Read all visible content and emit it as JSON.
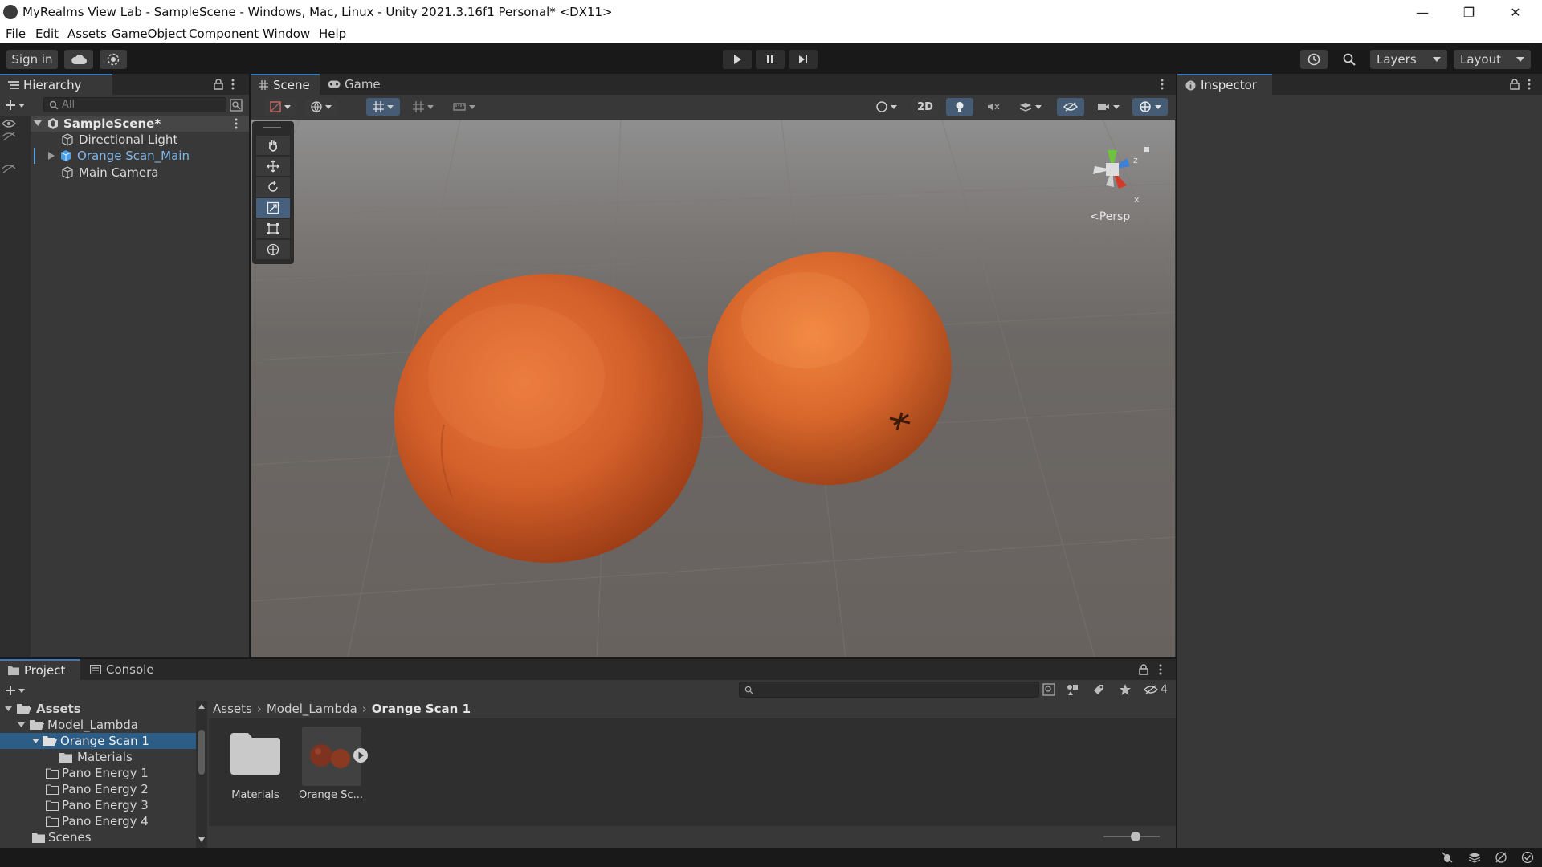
{
  "window": {
    "title": "MyRealms View Lab - SampleScene - Windows, Mac, Linux - Unity 2021.3.16f1 Personal* <DX11>",
    "controls": {
      "minimize": "—",
      "restore": "❐",
      "close": "✕"
    }
  },
  "menu": [
    "File",
    "Edit",
    "Assets",
    "GameObject",
    "Component",
    "Window",
    "Help"
  ],
  "toolbar": {
    "sign_in": "Sign in",
    "layers": "Layers",
    "layout": "Layout"
  },
  "hierarchy": {
    "tab": "Hierarchy",
    "search_placeholder": "All",
    "scene": "SampleScene*",
    "items": [
      {
        "label": "Directional Light",
        "selected": false
      },
      {
        "label": "Orange Scan_Main",
        "selected": true
      },
      {
        "label": "Main Camera",
        "selected": false
      }
    ]
  },
  "scene": {
    "tabs": [
      "Scene",
      "Game"
    ],
    "mode_2d": "2D",
    "projection": "Persp",
    "axes": {
      "x": "x",
      "y": "y",
      "z": "z"
    },
    "tools": [
      "hand",
      "move",
      "rotate",
      "scale",
      "rect",
      "transform"
    ]
  },
  "inspector": {
    "tab": "Inspector"
  },
  "project": {
    "tabs": [
      "Project",
      "Console"
    ],
    "hidden_count": "4",
    "breadcrumb": [
      "Assets",
      "Model_Lambda",
      "Orange Scan 1"
    ],
    "tree": [
      {
        "label": "Assets",
        "level": 0,
        "bold": true
      },
      {
        "label": "Model_Lambda",
        "level": 1
      },
      {
        "label": "Orange Scan 1",
        "level": 2,
        "selected": true
      },
      {
        "label": "Materials",
        "level": 3
      },
      {
        "label": "Pano Energy 1",
        "level": 2
      },
      {
        "label": "Pano Energy 2",
        "level": 2
      },
      {
        "label": "Pano Energy 3",
        "level": 2
      },
      {
        "label": "Pano Energy 4",
        "level": 2
      },
      {
        "label": "Scenes",
        "level": 1
      }
    ],
    "assets": [
      {
        "label": "Materials",
        "type": "folder"
      },
      {
        "label": "Orange Sc...",
        "type": "model"
      }
    ]
  },
  "colors": {
    "accent": "#3a79bb",
    "selection": "#2c5d87",
    "orange": "#d9622a",
    "panel": "#383838"
  }
}
